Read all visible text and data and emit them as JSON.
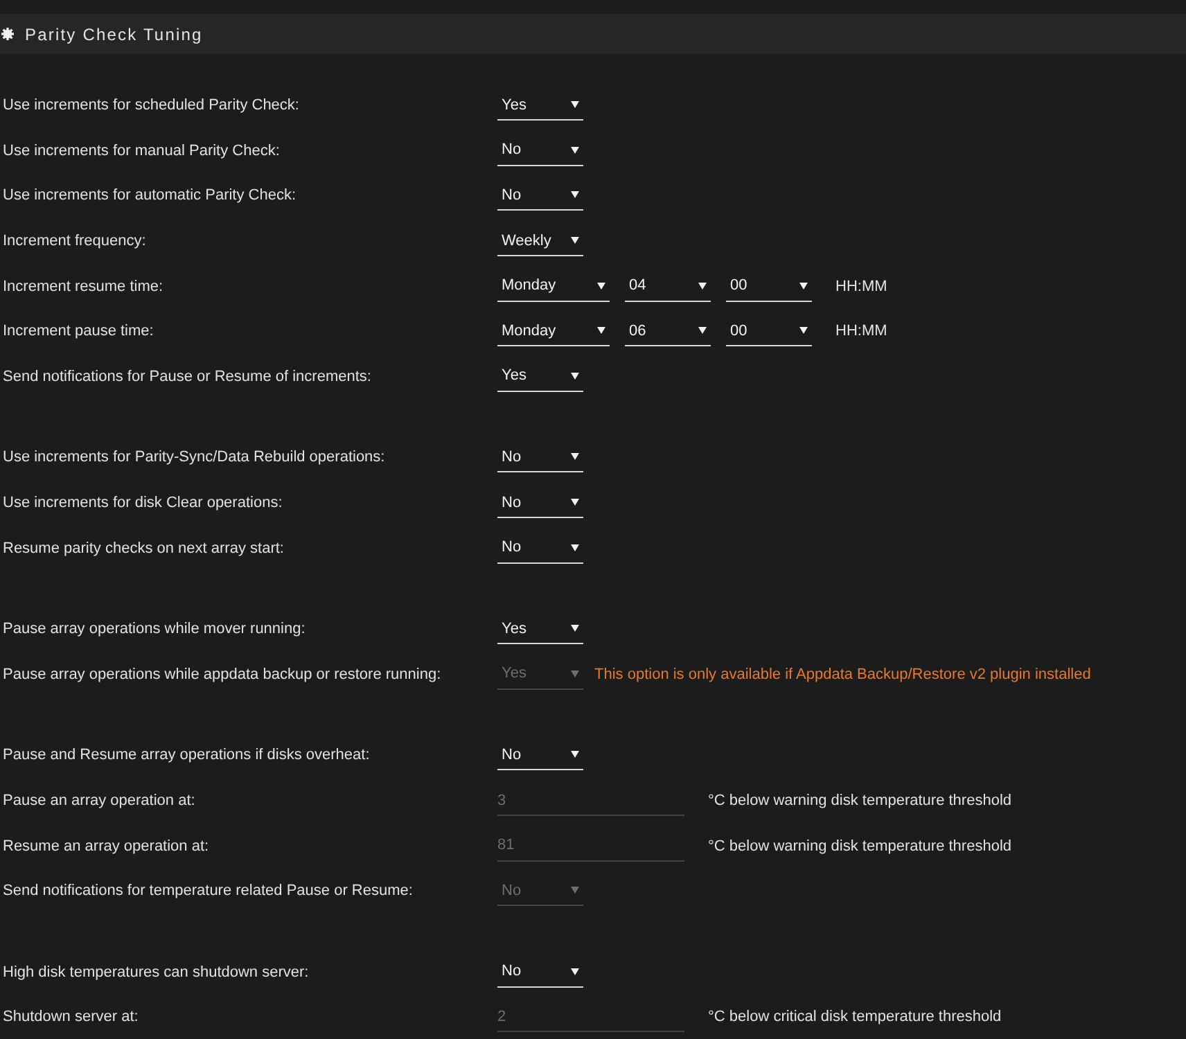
{
  "header": {
    "title": "Parity Check Tuning"
  },
  "groups": [
    {
      "rows": [
        {
          "label": "Use increments for scheduled Parity Check:",
          "controls": [
            {
              "kind": "select",
              "value": "Yes",
              "disabled": false
            }
          ]
        },
        {
          "label": "Use increments for manual Parity Check:",
          "controls": [
            {
              "kind": "select",
              "value": "No",
              "disabled": false
            }
          ]
        },
        {
          "label": "Use increments for automatic Parity Check:",
          "controls": [
            {
              "kind": "select",
              "value": "No",
              "disabled": false
            }
          ]
        },
        {
          "label": "Increment frequency:",
          "controls": [
            {
              "kind": "select",
              "value": "Weekly",
              "disabled": false
            }
          ]
        },
        {
          "label": "Increment resume time:",
          "controls": [
            {
              "kind": "wide-select",
              "value": "Monday",
              "disabled": false
            },
            {
              "kind": "select",
              "value": "04",
              "disabled": false
            },
            {
              "kind": "select",
              "value": "00",
              "disabled": false
            },
            {
              "kind": "suffix",
              "text": "HH:MM"
            }
          ]
        },
        {
          "label": "Increment pause time:",
          "controls": [
            {
              "kind": "wide-select",
              "value": "Monday",
              "disabled": false
            },
            {
              "kind": "select",
              "value": "06",
              "disabled": false
            },
            {
              "kind": "select",
              "value": "00",
              "disabled": false
            },
            {
              "kind": "suffix",
              "text": "HH:MM"
            }
          ]
        },
        {
          "label": "Send notifications for Pause or Resume of increments:",
          "controls": [
            {
              "kind": "select",
              "value": "Yes",
              "disabled": false
            }
          ]
        }
      ]
    },
    {
      "rows": [
        {
          "label": "Use increments for Parity-Sync/Data Rebuild operations:",
          "controls": [
            {
              "kind": "select",
              "value": "No",
              "disabled": false
            }
          ]
        },
        {
          "label": "Use increments for disk Clear operations:",
          "controls": [
            {
              "kind": "select",
              "value": "No",
              "disabled": false
            }
          ]
        },
        {
          "label": "Resume parity checks on next array start:",
          "controls": [
            {
              "kind": "select",
              "value": "No",
              "disabled": false
            }
          ]
        }
      ]
    },
    {
      "rows": [
        {
          "label": "Pause array operations while mover running:",
          "controls": [
            {
              "kind": "select",
              "value": "Yes",
              "disabled": false
            }
          ]
        },
        {
          "label": "Pause array operations while appdata backup or restore running:",
          "controls": [
            {
              "kind": "select",
              "value": "Yes",
              "disabled": true
            },
            {
              "kind": "warning",
              "text": "This option is only available if Appdata Backup/Restore v2 plugin installed"
            }
          ]
        }
      ]
    },
    {
      "rows": [
        {
          "label": "Pause and Resume array operations if disks overheat:",
          "controls": [
            {
              "kind": "select",
              "value": "No",
              "disabled": false
            }
          ]
        },
        {
          "label": "Pause an array operation at:",
          "controls": [
            {
              "kind": "input",
              "value": "3",
              "disabled": true
            },
            {
              "kind": "suffix",
              "text": "°C below warning disk temperature threshold"
            }
          ]
        },
        {
          "label": "Resume an array operation at:",
          "controls": [
            {
              "kind": "input",
              "value": "81",
              "disabled": true
            },
            {
              "kind": "suffix",
              "text": "°C below warning disk temperature threshold"
            }
          ]
        },
        {
          "label": "Send notifications for temperature related Pause or Resume:",
          "controls": [
            {
              "kind": "select",
              "value": "No",
              "disabled": true
            }
          ]
        }
      ]
    },
    {
      "rows": [
        {
          "label": "High disk temperatures can shutdown server:",
          "controls": [
            {
              "kind": "select",
              "value": "No",
              "disabled": false
            }
          ]
        },
        {
          "label": "Shutdown server at:",
          "controls": [
            {
              "kind": "input",
              "value": "2",
              "disabled": true
            },
            {
              "kind": "suffix",
              "text": "°C below critical disk temperature threshold"
            }
          ]
        }
      ]
    }
  ]
}
